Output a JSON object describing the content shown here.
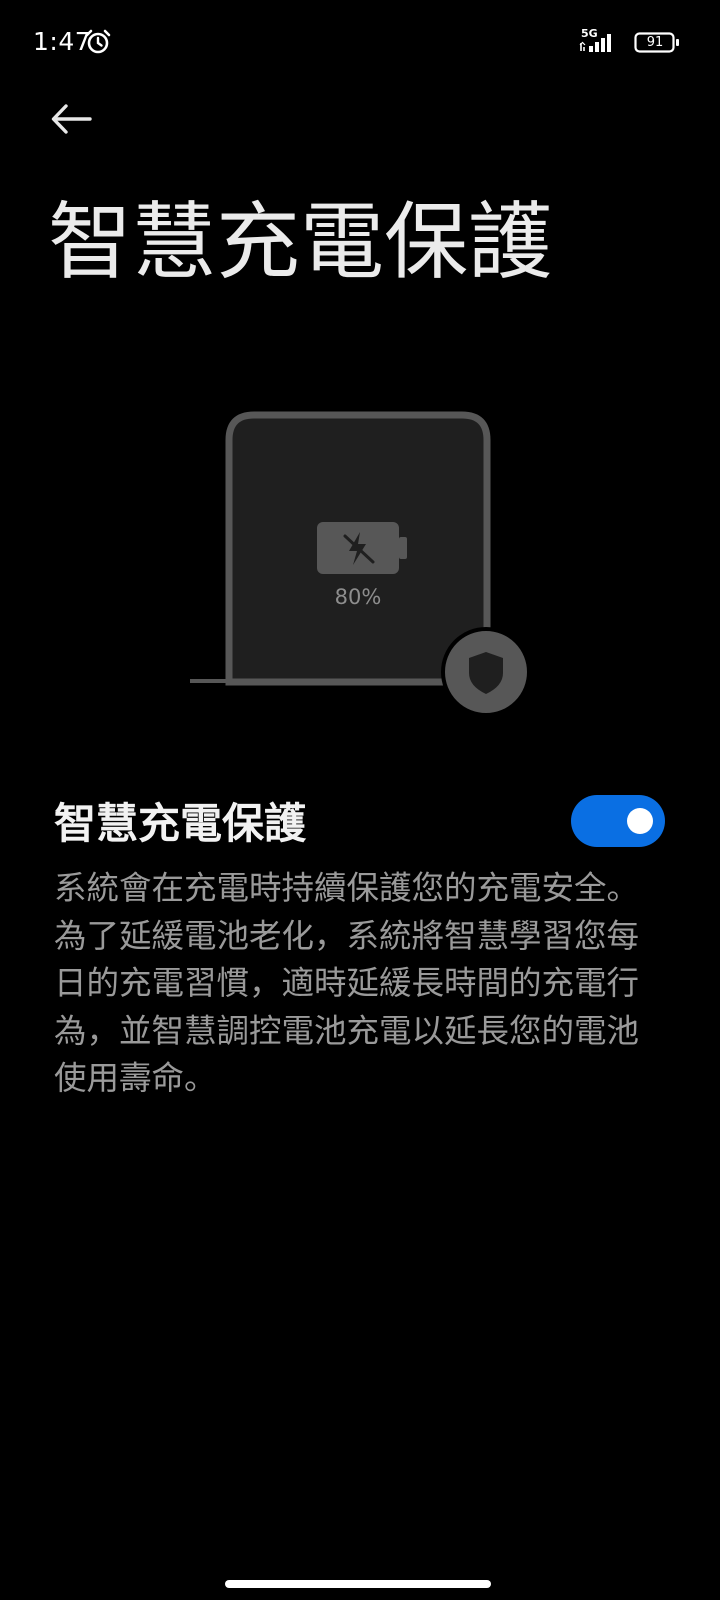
{
  "status_bar": {
    "time": "1:47",
    "alarm_icon": "alarm-clock-icon",
    "network": "5G",
    "signal_icon": "cellular-signal-icon",
    "battery_level": "91",
    "battery_icon": "battery-icon"
  },
  "header": {
    "back_icon": "arrow-left-icon",
    "title": "智慧充電保護"
  },
  "illustration": {
    "battery_percent": "80%",
    "icons": [
      "phone-outline-icon",
      "battery-charging-disabled-icon",
      "shield-icon"
    ]
  },
  "setting": {
    "title": "智慧充電保護",
    "enabled": true,
    "description": "系統會在充電時持續保護您的充電安全。為了延緩電池老化，系統將智慧學習您每日的充電習慣，適時延緩長時間的充電行為，並智慧調控電池充電以延長您的電池使用壽命。"
  },
  "colors": {
    "background": "#000000",
    "accent": "#0a6fe3",
    "title_text": "#ebebeb",
    "secondary_text": "#9a9a9a",
    "illustration_gray": "#575757"
  }
}
